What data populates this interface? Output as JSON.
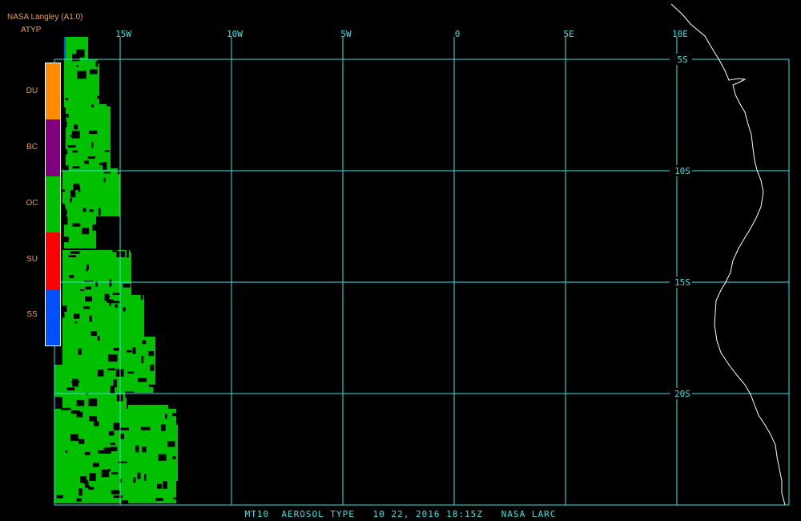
{
  "header": {
    "source": "NASA Langley (A1.0)",
    "product": "ATYP"
  },
  "footer": {
    "caption": "MT10  AEROSOL TYPE   10 22, 2016 18:15Z   NASA LARC"
  },
  "legend": [
    {
      "code": "DU",
      "color": "#ff8c00"
    },
    {
      "code": "BC",
      "color": "#800080"
    },
    {
      "code": "OC",
      "color": "#00c000"
    },
    {
      "code": "SU",
      "color": "#ff0000"
    },
    {
      "code": "SS",
      "color": "#0050ff"
    }
  ],
  "graticule": {
    "line_color": "#40e0e0",
    "longitudes": [
      {
        "value": -15,
        "label": "15W"
      },
      {
        "value": -10,
        "label": "10W"
      },
      {
        "value": -5,
        "label": "5W"
      },
      {
        "value": 0,
        "label": "0"
      },
      {
        "value": 5,
        "label": "5E"
      },
      {
        "value": 10,
        "label": "10E"
      }
    ],
    "latitudes": [
      {
        "value": -5,
        "label": "5S"
      },
      {
        "value": -10,
        "label": "10S"
      },
      {
        "value": -15,
        "label": "15S"
      },
      {
        "value": -20,
        "label": "20S"
      }
    ]
  },
  "coastline_color": "#ffffff",
  "aerosol_color": "#00c000"
}
